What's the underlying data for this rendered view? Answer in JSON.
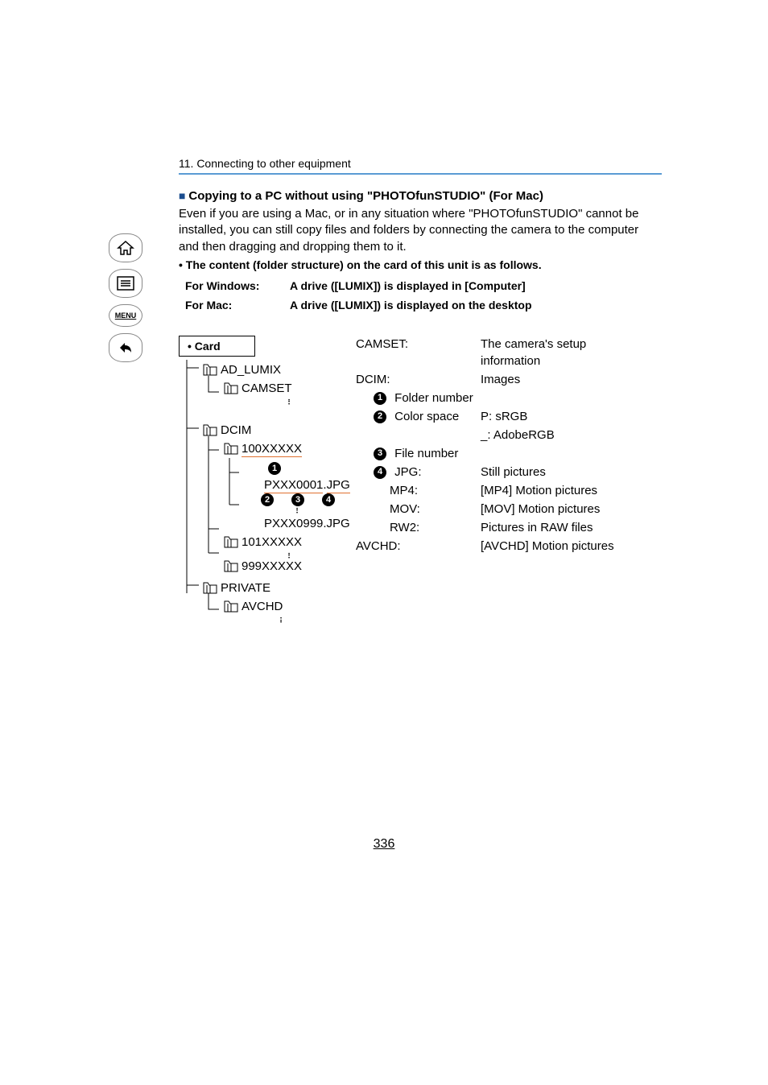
{
  "chapter": "11. Connecting to other equipment",
  "section_title": "Copying to a PC without using \"PHOTOfunSTUDIO\" (For Mac)",
  "intro": "Even if you are using a Mac, or in any situation where \"PHOTOfunSTUDIO\" cannot be installed, you can still copy files and folders by connecting the camera to the computer and then dragging and dropping them to it.",
  "bullet": "• The content (folder structure) on the card of this unit is as follows.",
  "os": {
    "windows_label": "For Windows:",
    "windows_desc": "A drive ([LUMIX]) is displayed in [Computer]",
    "mac_label": "For Mac:",
    "mac_desc": "A drive ([LUMIX]) is displayed on the desktop"
  },
  "tree": {
    "card": "• Card",
    "ad_lumix": "AD_LUMIX",
    "camset": "CAMSET",
    "dcim": "DCIM",
    "f100": "100XXXXX",
    "file1": "PXXX0001.JPG",
    "file999": "PXXX0999.JPG",
    "f101": "101XXXXX",
    "f999": "999XXXXX",
    "private": "PRIVATE",
    "avchd": "AVCHD"
  },
  "callouts": {
    "n1": "1",
    "n2": "2",
    "n3": "3",
    "n4": "4"
  },
  "info": {
    "camset_l": "CAMSET:",
    "camset_v": "The camera's setup information",
    "dcim_l": "DCIM:",
    "dcim_v": "Images",
    "folder_num": "Folder number",
    "color_space_l": "Color space",
    "color_space_v": "P: sRGB",
    "color_space_v2": "_: AdobeRGB",
    "file_num": "File number",
    "jpg_l": "JPG:",
    "jpg_v": "Still pictures",
    "mp4_l": "MP4:",
    "mp4_v": "[MP4] Motion pictures",
    "mov_l": "MOV:",
    "mov_v": "[MOV] Motion pictures",
    "rw2_l": "RW2:",
    "rw2_v": "Pictures in RAW files",
    "avchd_l": "AVCHD:",
    "avchd_v": "[AVCHD] Motion pictures"
  },
  "nav": {
    "menu": "MENU"
  },
  "page": "336"
}
